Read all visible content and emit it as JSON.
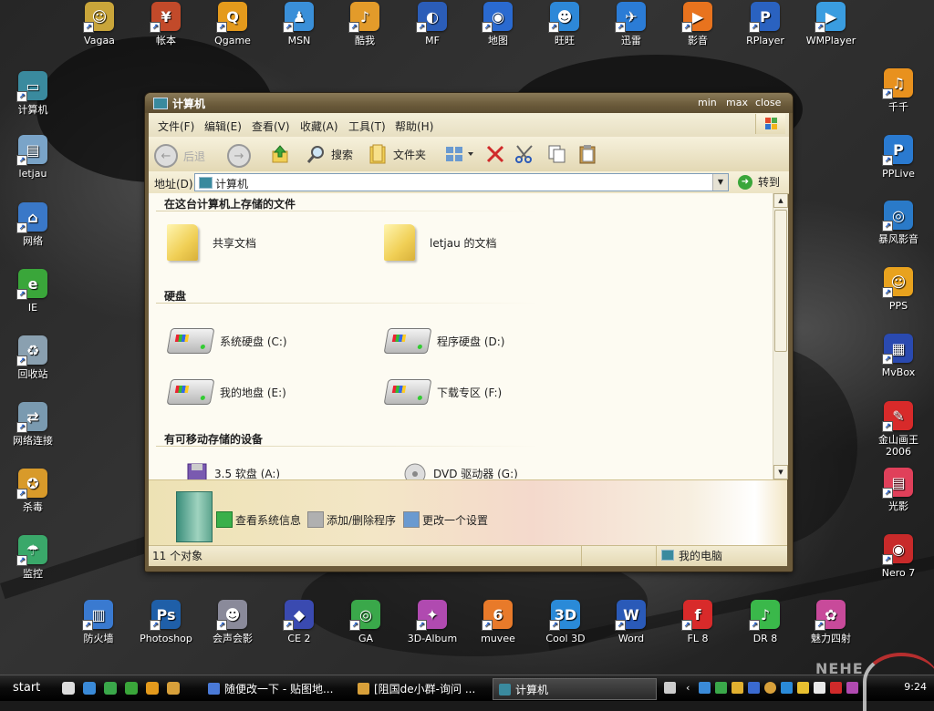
{
  "desktop": {
    "top_icons": [
      {
        "label": "Vagaa",
        "color": "#c9a53a",
        "glyph": "☺"
      },
      {
        "label": "帐本",
        "color": "#c24a2a",
        "glyph": "¥"
      },
      {
        "label": "Qgame",
        "color": "#e49a1c",
        "glyph": "Q"
      },
      {
        "label": "MSN",
        "color": "#3a8fd8",
        "glyph": "♟"
      },
      {
        "label": "酷我",
        "color": "#e39b2a",
        "glyph": "♪"
      },
      {
        "label": "MF",
        "color": "#2b5db8",
        "glyph": "◐"
      },
      {
        "label": "地图",
        "color": "#2a6ad0",
        "glyph": "◉"
      },
      {
        "label": "旺旺",
        "color": "#2d88d8",
        "glyph": "☻"
      },
      {
        "label": "迅雷",
        "color": "#2b7cd6",
        "glyph": "✈"
      },
      {
        "label": "影音",
        "color": "#e8731e",
        "glyph": "▶"
      },
      {
        "label": "RPlayer",
        "color": "#2a62c0",
        "glyph": "P"
      },
      {
        "label": "WMPlayer",
        "color": "#3a9de0",
        "glyph": "▶"
      }
    ],
    "left_icons": [
      {
        "label": "计算机",
        "color": "#3a8a9e",
        "glyph": "▭"
      },
      {
        "label": "letjau",
        "color": "#7aa4c8",
        "glyph": "▤"
      },
      {
        "label": "网络",
        "color": "#3a78c8",
        "glyph": "⌂"
      },
      {
        "label": "IE",
        "color": "#3aa63a",
        "glyph": "e"
      },
      {
        "label": "回收站",
        "color": "#8aa0b0",
        "glyph": "♻"
      },
      {
        "label": "网络连接",
        "color": "#7a9ab0",
        "glyph": "⇄"
      },
      {
        "label": "杀毒",
        "color": "#d89a2a",
        "glyph": "✪"
      },
      {
        "label": "监控",
        "color": "#3aa86a",
        "glyph": "☂"
      }
    ],
    "right_icons": [
      {
        "label": "千千",
        "color": "#e8911e",
        "glyph": "♫"
      },
      {
        "label": "PPLive",
        "color": "#2a7ad0",
        "glyph": "P"
      },
      {
        "label": "暴风影音",
        "color": "#2a7ac8",
        "glyph": "◎"
      },
      {
        "label": "PPS",
        "color": "#e8a21e",
        "glyph": "☺"
      },
      {
        "label": "MvBox",
        "color": "#2a4ab0",
        "glyph": "▦"
      },
      {
        "label": "金山画王 2006",
        "color": "#d82a2a",
        "glyph": "✎"
      },
      {
        "label": "光影",
        "color": "#e0405a",
        "glyph": "▤"
      },
      {
        "label": "Nero 7",
        "color": "#c82a2a",
        "glyph": "◉"
      }
    ],
    "bottom_icons": [
      {
        "label": "防火墙",
        "color": "#3a7ad0",
        "glyph": "▥"
      },
      {
        "label": "Photoshop",
        "color": "#1f5fa8",
        "glyph": "Ps"
      },
      {
        "label": "会声会影",
        "color": "#8a8a9a",
        "glyph": "☻"
      },
      {
        "label": "CE 2",
        "color": "#3a4ab0",
        "glyph": "◆"
      },
      {
        "label": "GA",
        "color": "#3aa84a",
        "glyph": "◎"
      },
      {
        "label": "3D-Album",
        "color": "#b04ab0",
        "glyph": "✦"
      },
      {
        "label": "muvee",
        "color": "#e87a2a",
        "glyph": "6"
      },
      {
        "label": "Cool 3D",
        "color": "#2a8ad8",
        "glyph": "3D"
      },
      {
        "label": "Word",
        "color": "#2a5ab8",
        "glyph": "W"
      },
      {
        "label": "FL 8",
        "color": "#d82a2a",
        "glyph": "f"
      },
      {
        "label": "DR 8",
        "color": "#3ab84a",
        "glyph": "♪"
      },
      {
        "label": "魅力四射",
        "color": "#c84a9a",
        "glyph": "✿"
      }
    ]
  },
  "window": {
    "title": "计算机",
    "buttons": {
      "min": "min",
      "max": "max",
      "close": "close"
    },
    "menu": [
      "文件(F)",
      "编辑(E)",
      "查看(V)",
      "收藏(A)",
      "工具(T)",
      "帮助(H)"
    ],
    "toolbar": {
      "back": "后退",
      "search": "搜索",
      "folders": "文件夹"
    },
    "address": {
      "label": "地址(D)",
      "value": "计算机",
      "go": "转到"
    },
    "sections": {
      "stored": "在这台计算机上存储的文件",
      "hdd": "硬盘",
      "removable": "有可移动存储的设备"
    },
    "stored_items": [
      "共享文档",
      "letjau 的文档"
    ],
    "drives": [
      "系统硬盘 (C:)",
      "程序硬盘 (D:)",
      "我的地盘 (E:)",
      "下载专区 (F:)"
    ],
    "removable_items": [
      "3.5 软盘 (A:)",
      "DVD 驱动器 (G:)"
    ],
    "tasks": [
      "查看系统信息",
      "添加/删除程序",
      "更改一个设置"
    ],
    "status": {
      "count": "11 个对象",
      "location": "我的电脑"
    }
  },
  "taskbar": {
    "start": "start",
    "tasks": [
      {
        "label": "随便改一下 - 贴图地...",
        "color": "#4a7ad8"
      },
      {
        "label": "[阻国de小群-询问 ...",
        "color": "#d8a03a"
      },
      {
        "label": "计算机",
        "color": "#3a8a9e"
      }
    ],
    "clock": "9:24",
    "watermark": "NEHE"
  }
}
